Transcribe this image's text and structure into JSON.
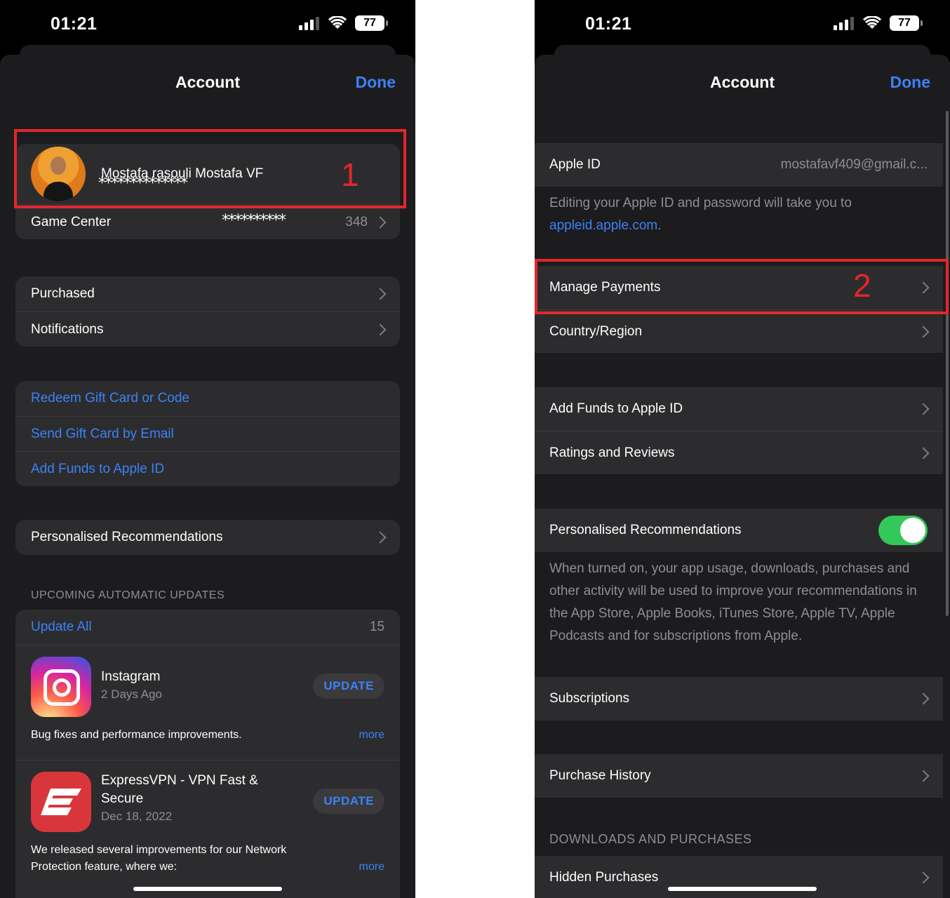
{
  "left": {
    "status": {
      "time": "01:21",
      "battery": "77"
    },
    "nav": {
      "title": "Account",
      "done": "Done"
    },
    "profile": {
      "name": "Mostafa rasouli Mostafa VF",
      "email_masked": "**************"
    },
    "game_center": {
      "label": "Game Center",
      "value_masked": "**********",
      "value_suffix": "348"
    },
    "menu1": {
      "purchased": "Purchased",
      "notifications": "Notifications"
    },
    "gift": {
      "redeem": "Redeem Gift Card or Code",
      "send": "Send Gift Card by Email",
      "add_funds": "Add Funds to Apple ID"
    },
    "recs": {
      "label": "Personalised Recommendations"
    },
    "updates": {
      "header": "UPCOMING AUTOMATIC UPDATES",
      "update_all": "Update All",
      "count": "15",
      "apps": [
        {
          "name": "Instagram",
          "sub": "2 Days Ago",
          "button": "UPDATE",
          "notes": "Bug fixes and performance improvements.",
          "more": "more"
        },
        {
          "name": "ExpressVPN - VPN Fast & Secure",
          "sub": "Dec 18, 2022",
          "button": "UPDATE",
          "notes": "We released several improvements for our Network Protection feature, where we:",
          "more": "more"
        }
      ]
    },
    "annotation": "1"
  },
  "right": {
    "status": {
      "time": "01:21",
      "battery": "77"
    },
    "nav": {
      "title": "Account",
      "done": "Done"
    },
    "apple_id": {
      "label": "Apple ID",
      "value": "mostafavf409@gmail.c..."
    },
    "apple_id_note": {
      "text": "Editing your Apple ID and password will take you to",
      "link": "appleid.apple.com",
      "end": "."
    },
    "manage_payments": "Manage Payments",
    "country_region": "Country/Region",
    "add_funds": "Add Funds to Apple ID",
    "ratings": "Ratings and Reviews",
    "recs": {
      "label": "Personalised Recommendations",
      "enabled": true
    },
    "recs_note": "When turned on, your app usage, downloads, purchases and other activity will be used to improve your recommendations in the App Store, Apple Books, iTunes Store, Apple TV, Apple Podcasts and for subscriptions from Apple.",
    "subscriptions": "Subscriptions",
    "purchase_history": "Purchase History",
    "downloads_header": "DOWNLOADS AND PURCHASES",
    "hidden_purchases": "Hidden Purchases",
    "annotation": "2"
  },
  "colors": {
    "accent": "#3b82f6",
    "annotation": "#e3262b",
    "toggle_on": "#34c759",
    "background": "#1c1c1e",
    "cell": "#2c2c2e"
  }
}
